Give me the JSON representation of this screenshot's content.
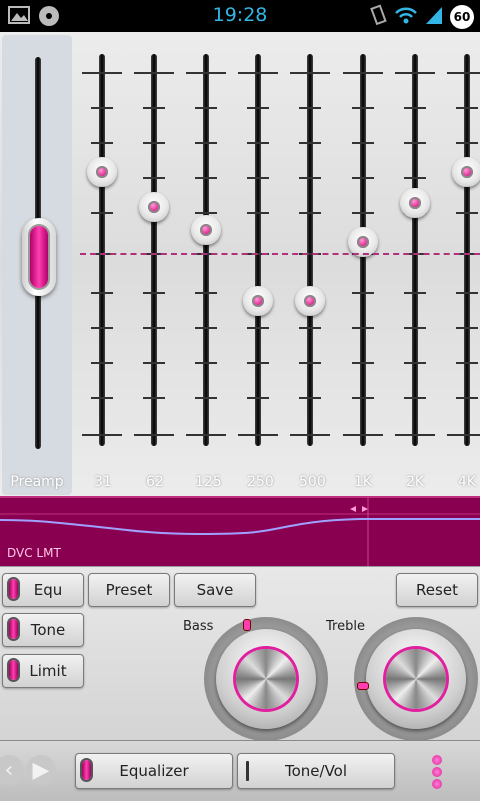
{
  "status_bar": {
    "time": "19:28",
    "battery_level": "60",
    "icons": [
      "gallery-icon",
      "music-disc-icon",
      "vibrate-icon",
      "wifi-icon",
      "signal-icon",
      "battery-icon"
    ]
  },
  "equalizer": {
    "preamp_label": "Preamp",
    "preamp_level": 0.5,
    "bands": [
      {
        "label": "31",
        "level": 0.7
      },
      {
        "label": "62",
        "level": 0.61
      },
      {
        "label": "125",
        "level": 0.55
      },
      {
        "label": "250",
        "level": 0.37
      },
      {
        "label": "500",
        "level": 0.37
      },
      {
        "label": "1K",
        "level": 0.52
      },
      {
        "label": "2K",
        "level": 0.62
      },
      {
        "label": "4K",
        "level": 0.7
      }
    ]
  },
  "graph": {
    "label": "DVC LMT"
  },
  "controls": {
    "equ_label": "Equ",
    "preset_label": "Preset",
    "save_label": "Save",
    "reset_label": "Reset",
    "tone_label": "Tone",
    "limit_label": "Limit",
    "bass_label": "Bass",
    "treble_label": "Treble"
  },
  "bottom_bar": {
    "equalizer_tab": "Equalizer",
    "tone_vol_tab": "Tone/Vol"
  },
  "colors": {
    "accent": "#e0209f",
    "graph_bg": "#8a0050",
    "status_text": "#33b5e5"
  }
}
